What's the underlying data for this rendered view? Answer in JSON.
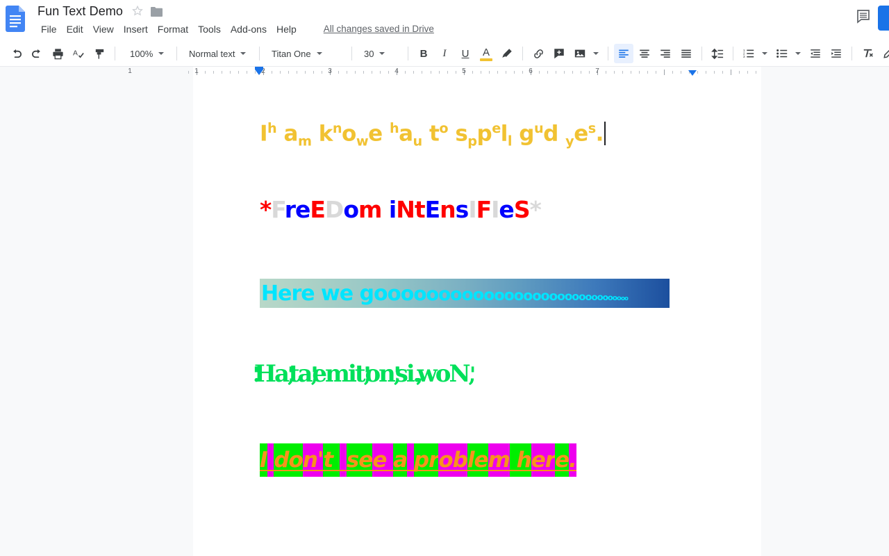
{
  "app": {
    "doc_title": "Fun Text Demo",
    "doc_icon": "google-docs-icon",
    "star_icon": "star-outline-icon",
    "folder_icon": "folder-icon",
    "save_status": "All changes saved in Drive",
    "comment_icon": "comment-icon",
    "share_label": ""
  },
  "menu": {
    "items": [
      {
        "label": "File"
      },
      {
        "label": "Edit"
      },
      {
        "label": "View"
      },
      {
        "label": "Insert"
      },
      {
        "label": "Format"
      },
      {
        "label": "Tools"
      },
      {
        "label": "Add-ons"
      },
      {
        "label": "Help"
      }
    ]
  },
  "toolbar": {
    "undo_icon": "undo-icon",
    "redo_icon": "redo-icon",
    "print_icon": "print-icon",
    "spellcheck_icon": "spellcheck-icon",
    "paint_format_icon": "paint-format-icon",
    "zoom_value": "100%",
    "paragraph_style_value": "Normal text",
    "font_family_value": "Titan One",
    "font_size_value": "30",
    "bold_label": "B",
    "italic_label": "I",
    "underline_label": "U",
    "text_color_label": "A",
    "text_color_swatch": "#f1c232",
    "highlight_icon": "highlight-pen-icon",
    "link_icon": "insert-link-icon",
    "comment_add_icon": "add-comment-icon",
    "image_icon": "insert-image-icon",
    "align_left_icon": "align-left-icon",
    "align_center_icon": "align-center-icon",
    "align_right_icon": "align-right-icon",
    "align_justify_icon": "align-justify-icon",
    "line_spacing_icon": "line-spacing-icon",
    "numbered_list_icon": "numbered-list-icon",
    "bulleted_list_icon": "bulleted-list-icon",
    "decrease_indent_icon": "decrease-indent-icon",
    "increase_indent_icon": "increase-indent-icon",
    "clear_formatting_icon": "clear-formatting-icon",
    "edit_mode_icon": "pencil-edit-icon",
    "active_alignment": "align-left"
  },
  "sidebar": {
    "outline_toggle_icon": "document-outline-icon"
  },
  "ruler": {
    "unit_labels": [
      "1",
      "2",
      "3",
      "4",
      "5",
      "6",
      "7"
    ],
    "left_indent_marker": "left-indent-marker",
    "right_indent_marker": "right-indent-marker"
  },
  "document": {
    "line1": {
      "plain_text": "I am knowe hau to sppel gud yes.",
      "color": "#f1c232",
      "runs": [
        {
          "t": "I",
          "p": "base"
        },
        {
          "t": "h",
          "p": "sup"
        },
        {
          "t": " a",
          "p": "base"
        },
        {
          "t": "m",
          "p": "sub"
        },
        {
          "t": " k",
          "p": "base"
        },
        {
          "t": "n",
          "p": "sup"
        },
        {
          "t": "o",
          "p": "base"
        },
        {
          "t": "w",
          "p": "sub"
        },
        {
          "t": "e",
          "p": "base"
        },
        {
          "t": " ",
          "p": "base"
        },
        {
          "t": "h",
          "p": "sup"
        },
        {
          "t": "a",
          "p": "base"
        },
        {
          "t": "u",
          "p": "sub"
        },
        {
          "t": " t",
          "p": "base"
        },
        {
          "t": "o",
          "p": "sup"
        },
        {
          "t": " s",
          "p": "base"
        },
        {
          "t": "p",
          "p": "sub"
        },
        {
          "t": "p",
          "p": "base"
        },
        {
          "t": "e",
          "p": "sup"
        },
        {
          "t": "l",
          "p": "base"
        },
        {
          "t": "l",
          "p": "sub"
        },
        {
          "t": " g",
          "p": "base"
        },
        {
          "t": "u",
          "p": "sup"
        },
        {
          "t": "d",
          "p": "base"
        },
        {
          "t": " ",
          "p": "base"
        },
        {
          "t": "y",
          "p": "sub"
        },
        {
          "t": "e",
          "p": "base"
        },
        {
          "t": "s",
          "p": "sup"
        },
        {
          "t": ".",
          "p": "base"
        }
      ]
    },
    "line2": {
      "plain_text": "*FreEDom iNtEnsIFIeS*",
      "colors": {
        "red": "#ff0000",
        "blue": "#0000ff",
        "gray": "#d9d9d9"
      },
      "runs": [
        {
          "t": "*",
          "c": "#ff0000"
        },
        {
          "t": "F",
          "c": "#d9d9d9"
        },
        {
          "t": "r",
          "c": "#0000ff"
        },
        {
          "t": "e",
          "c": "#0000ff"
        },
        {
          "t": "E",
          "c": "#ff0000"
        },
        {
          "t": "D",
          "c": "#d9d9d9"
        },
        {
          "t": "o",
          "c": "#0000ff"
        },
        {
          "t": "m",
          "c": "#ff0000"
        },
        {
          "t": " ",
          "c": "#d9d9d9"
        },
        {
          "t": "i",
          "c": "#0000ff"
        },
        {
          "t": "N",
          "c": "#ff0000"
        },
        {
          "t": "t",
          "c": "#ff0000"
        },
        {
          "t": "E",
          "c": "#0000ff"
        },
        {
          "t": "n",
          "c": "#ff0000"
        },
        {
          "t": "s",
          "c": "#0000ff"
        },
        {
          "t": "I",
          "c": "#d9d9d9"
        },
        {
          "t": "F",
          "c": "#ff0000"
        },
        {
          "t": "I",
          "c": "#d9d9d9"
        },
        {
          "t": "e",
          "c": "#0000ff"
        },
        {
          "t": "S",
          "c": "#ff0000"
        },
        {
          "t": "*",
          "c": "#d9d9d9"
        }
      ]
    },
    "line3": {
      "plain_text": "Here we goooooooooooooooooooooooooooooo",
      "text_color": "#00e5ff",
      "highlight_gradient_from": "#b8d8c8",
      "highlight_gradient_to": "#1c4f9e",
      "prefix": "Here we g",
      "o_count": 30
    },
    "line4": {
      "plain_text": "'.Ha ta emit on si ...woN .'",
      "color": "#00e05a",
      "segments": [
        {
          "t": "'.'"
        },
        {
          "t": "Ha"
        },
        {
          "t": "','"
        },
        {
          "t": "ta"
        },
        {
          "t": "','"
        },
        {
          "t": "emit"
        },
        {
          "t": "','"
        },
        {
          "t": "on"
        },
        {
          "t": "','"
        },
        {
          "t": "si"
        },
        {
          "t": "...,"
        },
        {
          "t": "woN"
        },
        {
          "t": ",'"
        }
      ]
    },
    "line5": {
      "plain_text": "I don't see a problem here.",
      "text_color": "#f6921e",
      "underline": true,
      "highlight_green": "#00ee00",
      "highlight_magenta": "#ee00ee",
      "segments": [
        {
          "t": "I",
          "h": "g"
        },
        {
          "t": " ",
          "h": "m"
        },
        {
          "t": "do",
          "h": "g"
        },
        {
          "t": "n'",
          "h": "m"
        },
        {
          "t": "t ",
          "h": "g"
        },
        {
          "t": " ",
          "h": "m"
        },
        {
          "t": "se",
          "h": "g"
        },
        {
          "t": "e ",
          "h": "m"
        },
        {
          "t": "a",
          "h": "g"
        },
        {
          "t": " ",
          "h": "m"
        },
        {
          "t": "pr",
          "h": "g"
        },
        {
          "t": "ob",
          "h": "m"
        },
        {
          "t": "le",
          "h": "g"
        },
        {
          "t": "m",
          "h": "m"
        },
        {
          "t": " h",
          "h": "g"
        },
        {
          "t": "er",
          "h": "m"
        },
        {
          "t": "e",
          "h": "g"
        },
        {
          "t": ".",
          "h": "m"
        }
      ]
    }
  }
}
